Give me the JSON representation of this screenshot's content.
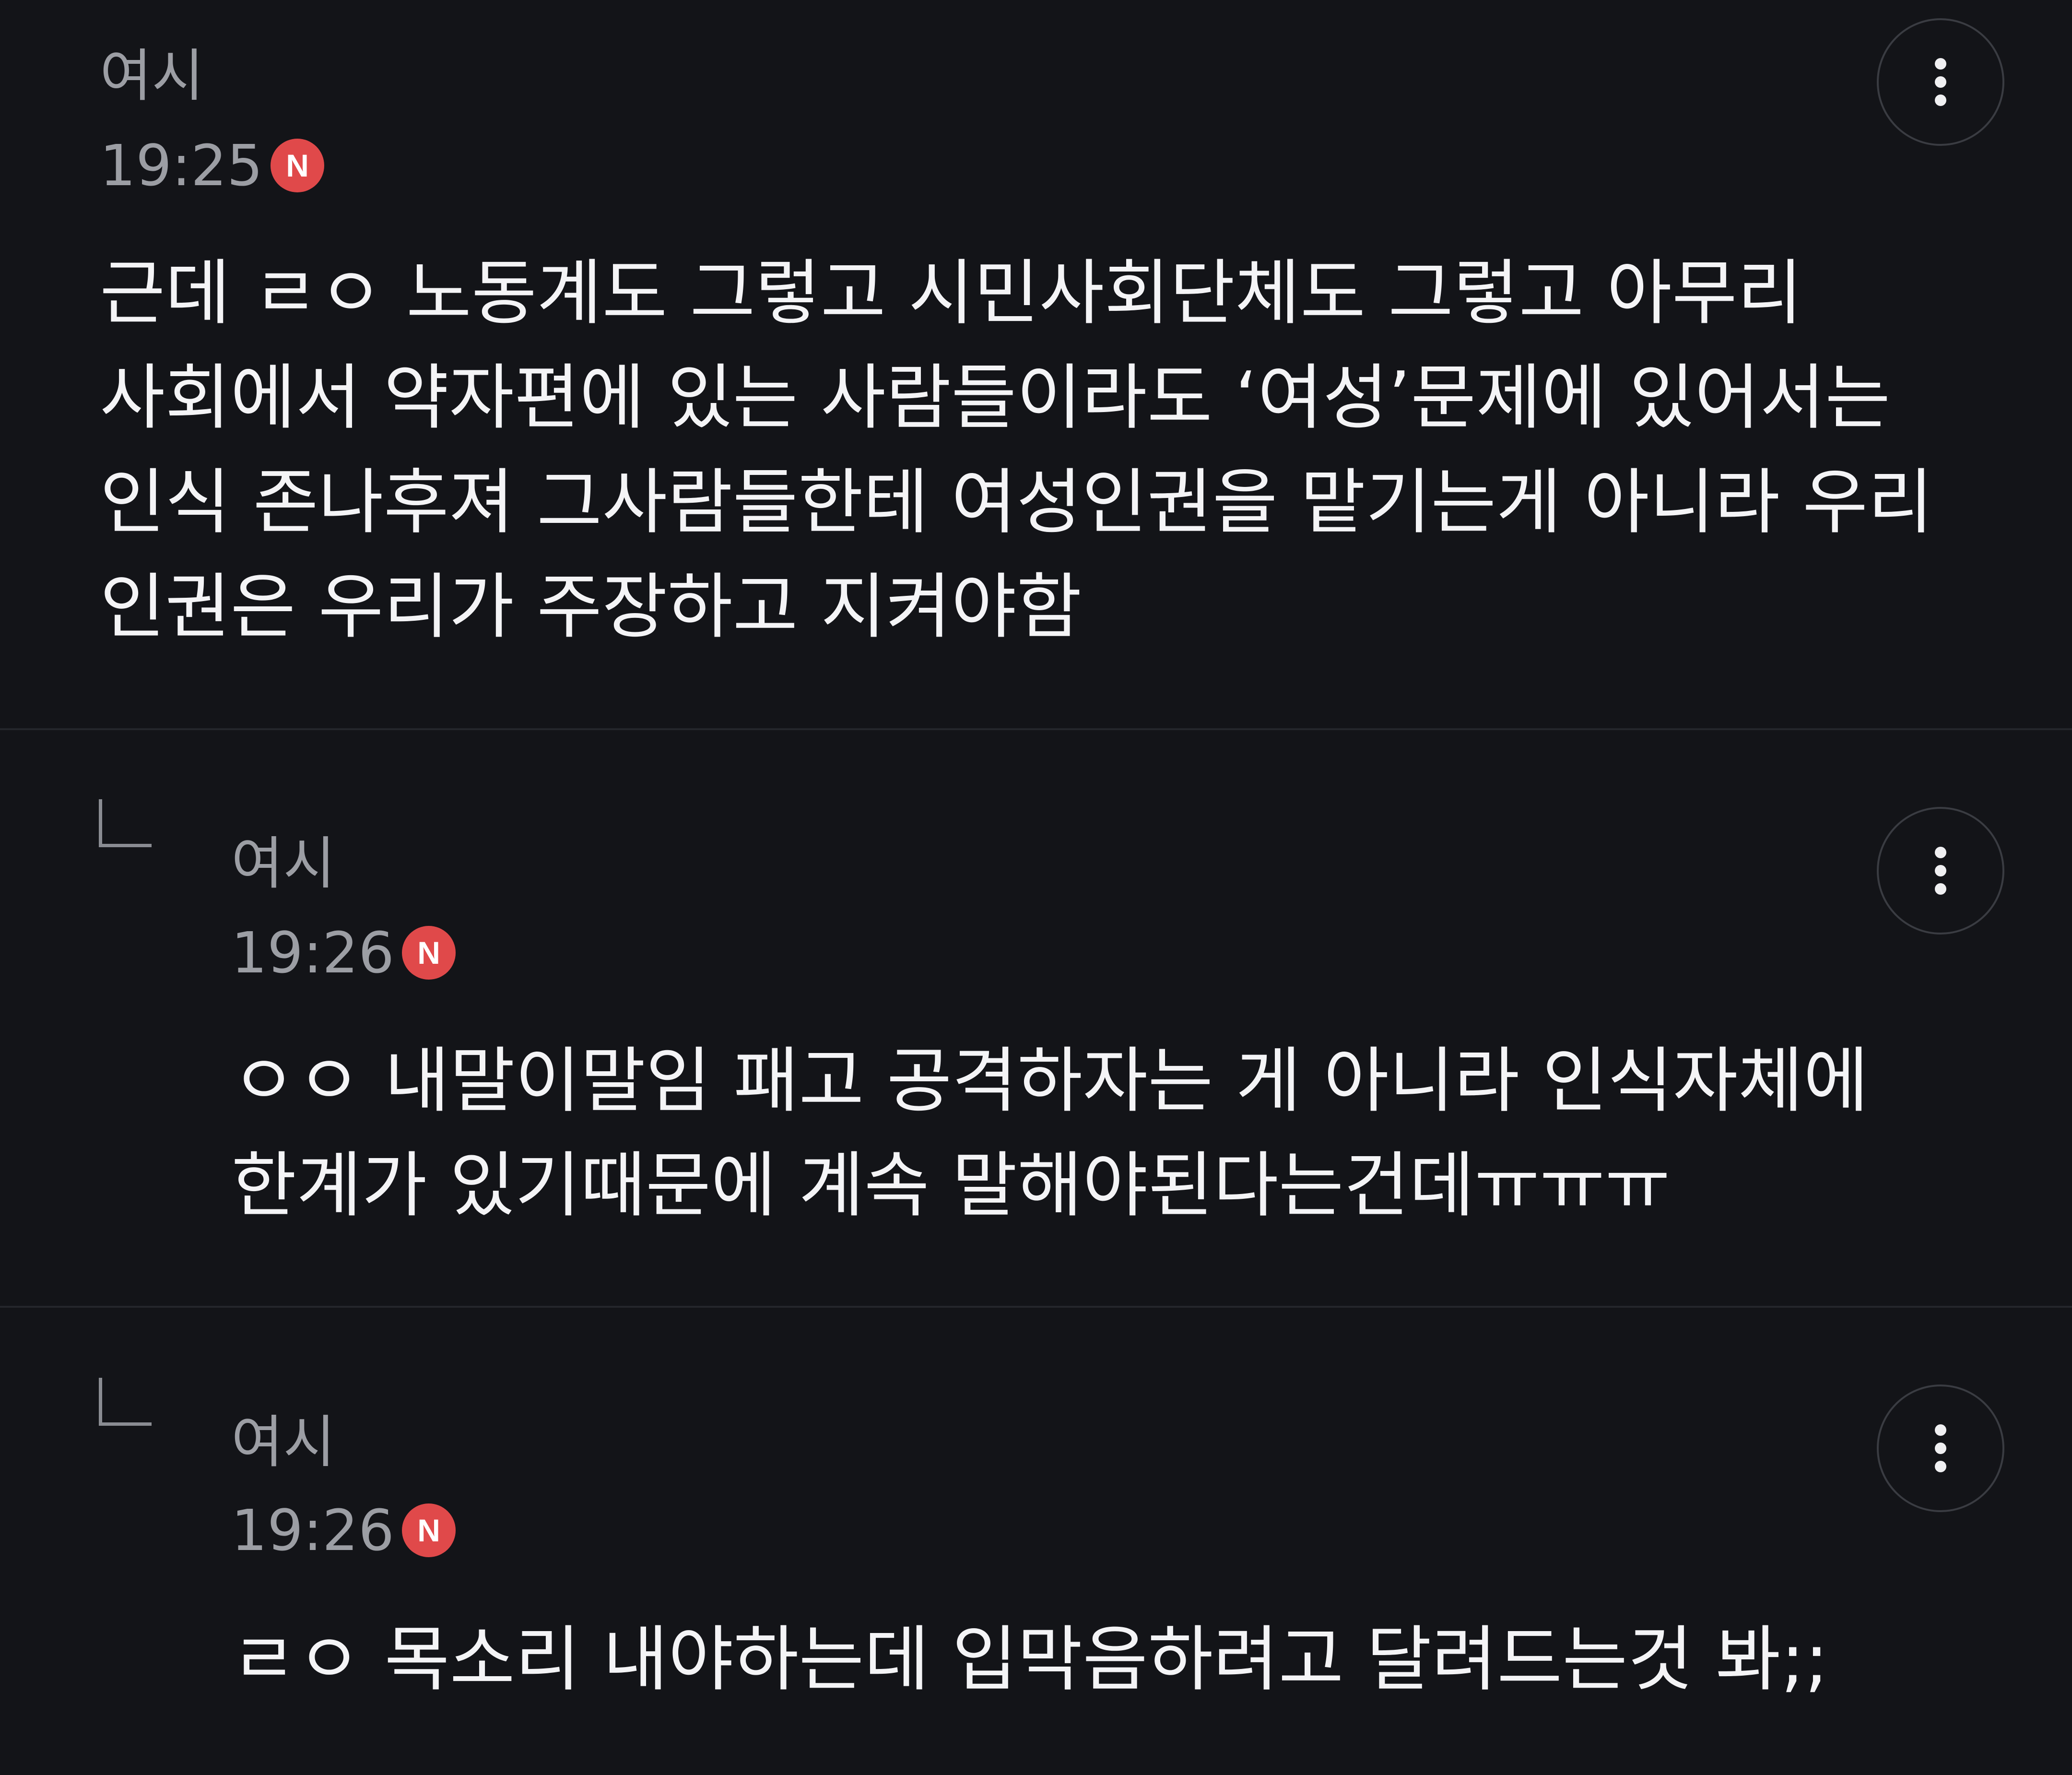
{
  "comments": [
    {
      "author": "여시",
      "time": "19:25",
      "badge": "N",
      "text": "근데 ㄹㅇ 노동계도 그렇고 시민사회단체도 그렇고 아무리\n사회에서 약자편에 있는 사람들이라도 ‘여성’문제에 있어서는\n인식 존나후져 그사람들한테 여성인권을 맡기는게 아니라 우리\n인권은 우리가 주장하고 지켜야함"
    },
    {
      "author": "여시",
      "time": "19:26",
      "badge": "N",
      "text": "ㅇㅇ 내말이말임 패고 공격하자는 게 아니라 인식자체에\n한계가 있기때문에 계속 말해야된다는건데ㅠㅠㅠ"
    },
    {
      "author": "여시",
      "time": "19:26",
      "badge": "N",
      "text": "ㄹㅇ 목소리 내야하는데 입막음하려고 달려드는것 봐;;"
    }
  ],
  "icons": {
    "more": "more-vertical-icon",
    "reply": "reply-arrow-icon"
  },
  "colors": {
    "background": "#131418",
    "badge": "#e0494a",
    "meta_text": "#9c9ea4",
    "body_text": "#f4f4f6"
  }
}
